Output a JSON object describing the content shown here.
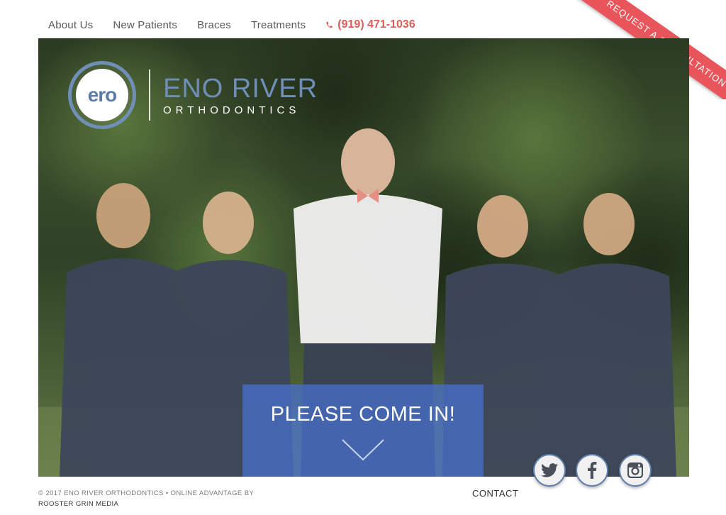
{
  "nav": {
    "items": [
      {
        "label": "About Us"
      },
      {
        "label": "New Patients"
      },
      {
        "label": "Braces"
      },
      {
        "label": "Treatments"
      }
    ],
    "phone": "(919) 471-1036",
    "phone_icon": "phone-icon"
  },
  "ribbon": {
    "label": "REQUEST A CONSULTATION"
  },
  "hero": {
    "logo_mark": "ero",
    "logo_title": "ENO RIVER",
    "logo_subtitle": "ORTHODONTICS",
    "cta_label": "PLEASE COME IN!",
    "cta_icon": "chevron-down-icon"
  },
  "social": [
    {
      "name": "twitter-icon"
    },
    {
      "name": "facebook-icon"
    },
    {
      "name": "instagram-icon"
    }
  ],
  "footer": {
    "copyright": "© 2017 ENO RIVER ORTHODONTICS • ONLINE ADVANTAGE BY",
    "credit": "ROOSTER GRIN MEDIA",
    "contact": "CONTACT"
  },
  "colors": {
    "accent": "#e8555a",
    "brand_blue": "#6f8fb7",
    "cta_blue": "#466ec8"
  }
}
